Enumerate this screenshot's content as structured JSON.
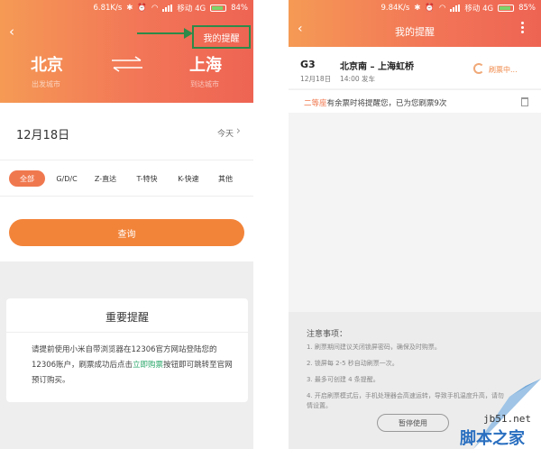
{
  "left": {
    "status": {
      "speed": "6.81K/s",
      "network": "移动 4G",
      "battery": "84%"
    },
    "header": {
      "reminder_label": "我的提醒"
    },
    "route": {
      "from_city": "北京",
      "from_sub": "出发城市",
      "to_city": "上海",
      "to_sub": "到达城市"
    },
    "date": {
      "value": "12月18日",
      "today_label": "今天"
    },
    "filters": [
      "全部",
      "G/D/C",
      "Z-直达",
      "T-特快",
      "K-快速",
      "其他"
    ],
    "query_label": "查询",
    "notice": {
      "title": "重要提醒",
      "body_before": "请提前使用小米自带浏览器在12306官方网站登陆您的12306账户，刷票成功后点击",
      "link": "立即购票",
      "body_after": "按钮即可跳转至官网预订购买。"
    }
  },
  "right": {
    "status": {
      "speed": "9.84K/s",
      "network": "移动 4G",
      "battery": "85%"
    },
    "title": "我的提醒",
    "trip": {
      "train_no": "G3",
      "date": "12月18日",
      "route": "北京南 – 上海虹桥",
      "depart": "14:00 发车",
      "status": "刷票中..."
    },
    "seat_reminder": {
      "seat": "二等座",
      "text": "有余票时将提醒您，已为您刷票9次"
    },
    "tips": {
      "title": "注意事项：",
      "items": [
        "1. 刷票期间建议关闭锁屏密码，确保及时购票。",
        "2. 锁屏每 2-5 秒自动刷票一次。",
        "3. 最多可创建 4 条提醒。",
        "4. 开启刷票模式后，手机处理器会高速运转，导致手机温度升高，请勿",
        "情设置。"
      ],
      "stop_label": "暂停使用"
    }
  },
  "watermark": {
    "site": "jb51.net",
    "name": "脚本之家"
  }
}
